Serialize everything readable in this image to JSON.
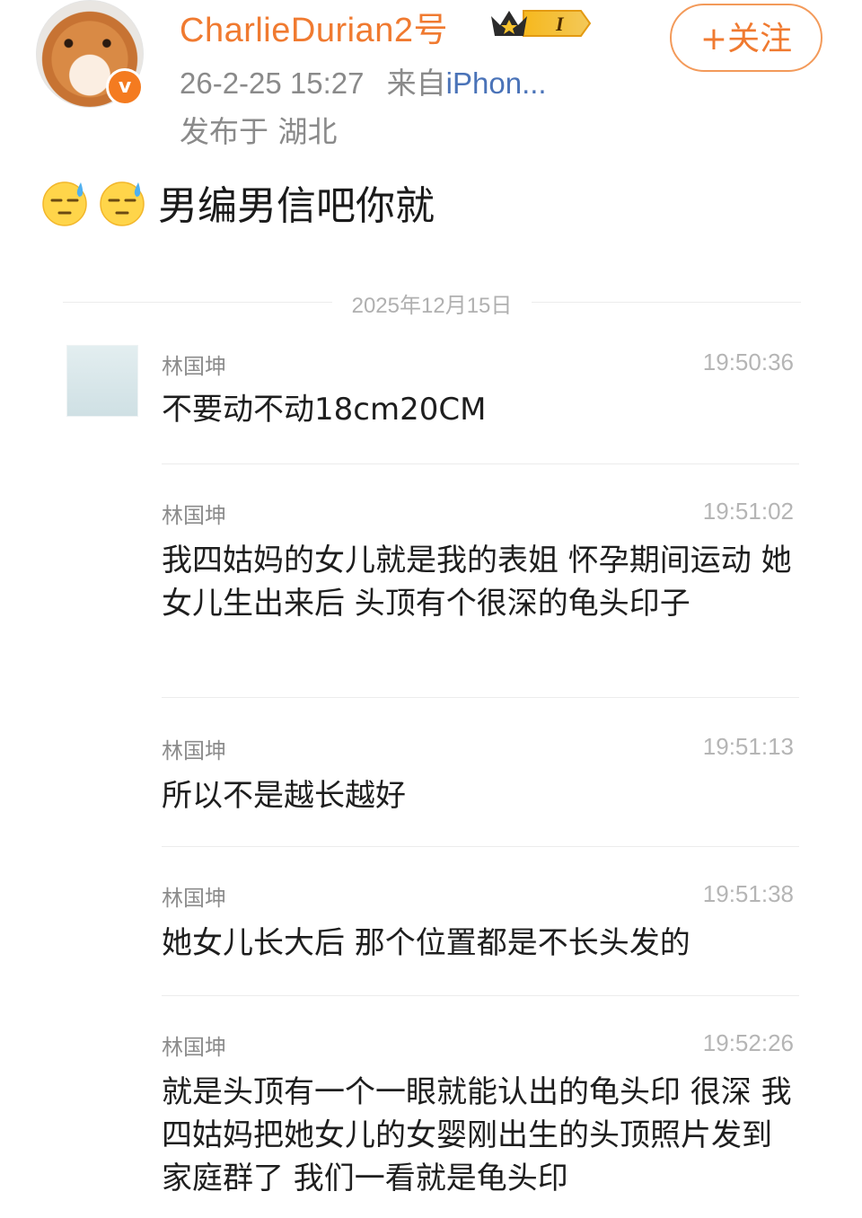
{
  "post": {
    "username": "CharlieDurian2号",
    "vip_level": "I",
    "timestamp": "26-2-25 15:27",
    "source_prefix": "来自",
    "source": "iPhon...",
    "location": "发布于 湖北",
    "follow_label": "+关注",
    "text": "男编男信吧你就",
    "emojis": [
      "sweat-face-icon",
      "sweat-face-icon"
    ]
  },
  "chat": {
    "date": "2025年12月15日",
    "messages": [
      {
        "sender": "林国坤",
        "time": "19:50:36",
        "text": "不要动不动18cm20CM"
      },
      {
        "sender": "林国坤",
        "time": "19:51:02",
        "text": "我四姑妈的女儿就是我的表姐 怀孕期间运动 她女儿生出来后 头顶有个很深的龟头印子"
      },
      {
        "sender": "林国坤",
        "time": "19:51:13",
        "text": "所以不是越长越好"
      },
      {
        "sender": "林国坤",
        "time": "19:51:38",
        "text": "她女儿长大后 那个位置都是不长头发的"
      },
      {
        "sender": "林国坤",
        "time": "19:52:26",
        "text": "就是头顶有一个一眼就能认出的龟头印 很深 我四姑妈把她女儿的女婴刚出生的头顶照片发到家庭群了 我们一看就是龟头印"
      }
    ]
  },
  "colors": {
    "username": "#f07a30",
    "follow": "#f07a30",
    "source_link": "#4a73b8"
  }
}
